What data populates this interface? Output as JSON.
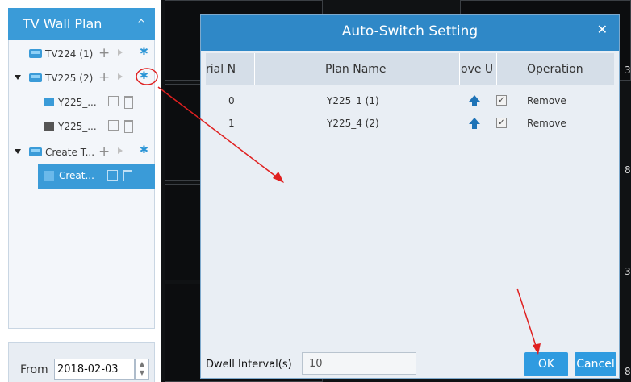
{
  "left_panel": {
    "title": "TV Wall Plan",
    "collapse_glyph": "^",
    "items": [
      {
        "label": "TV224 (1)",
        "plus": "+",
        "gear": "✱"
      },
      {
        "label": "TV225 (2)",
        "plus": "+",
        "gear": "✱"
      },
      {
        "label": "Y225_..."
      },
      {
        "label": "Y225_..."
      },
      {
        "label": "Create T...",
        "plus": "+",
        "gear": "✱"
      },
      {
        "label": "Creat..."
      }
    ],
    "from_label": "From",
    "from_value": "2018-02-03",
    "spin_up": "▲",
    "spin_down": "▼"
  },
  "wall": {
    "edge_numbers": [
      "3",
      "8",
      "3",
      "8"
    ]
  },
  "dialog": {
    "title": "Auto-Switch Setting",
    "close_glyph": "✕",
    "columns": [
      "rial N",
      "Plan Name",
      "ove U",
      "Operation"
    ],
    "rows": [
      {
        "serial": "0",
        "plan_name": "Y225_1 (1)",
        "checked": "✓",
        "operation": "Remove"
      },
      {
        "serial": "1",
        "plan_name": "Y225_4 (2)",
        "checked": "✓",
        "operation": "Remove"
      }
    ],
    "dwell_label": "Dwell Interval(s)",
    "dwell_value": "10",
    "ok_label": "OK",
    "cancel_label": "Cancel"
  },
  "colors": {
    "accent": "#2f88c7",
    "annotation": "#e02020"
  }
}
